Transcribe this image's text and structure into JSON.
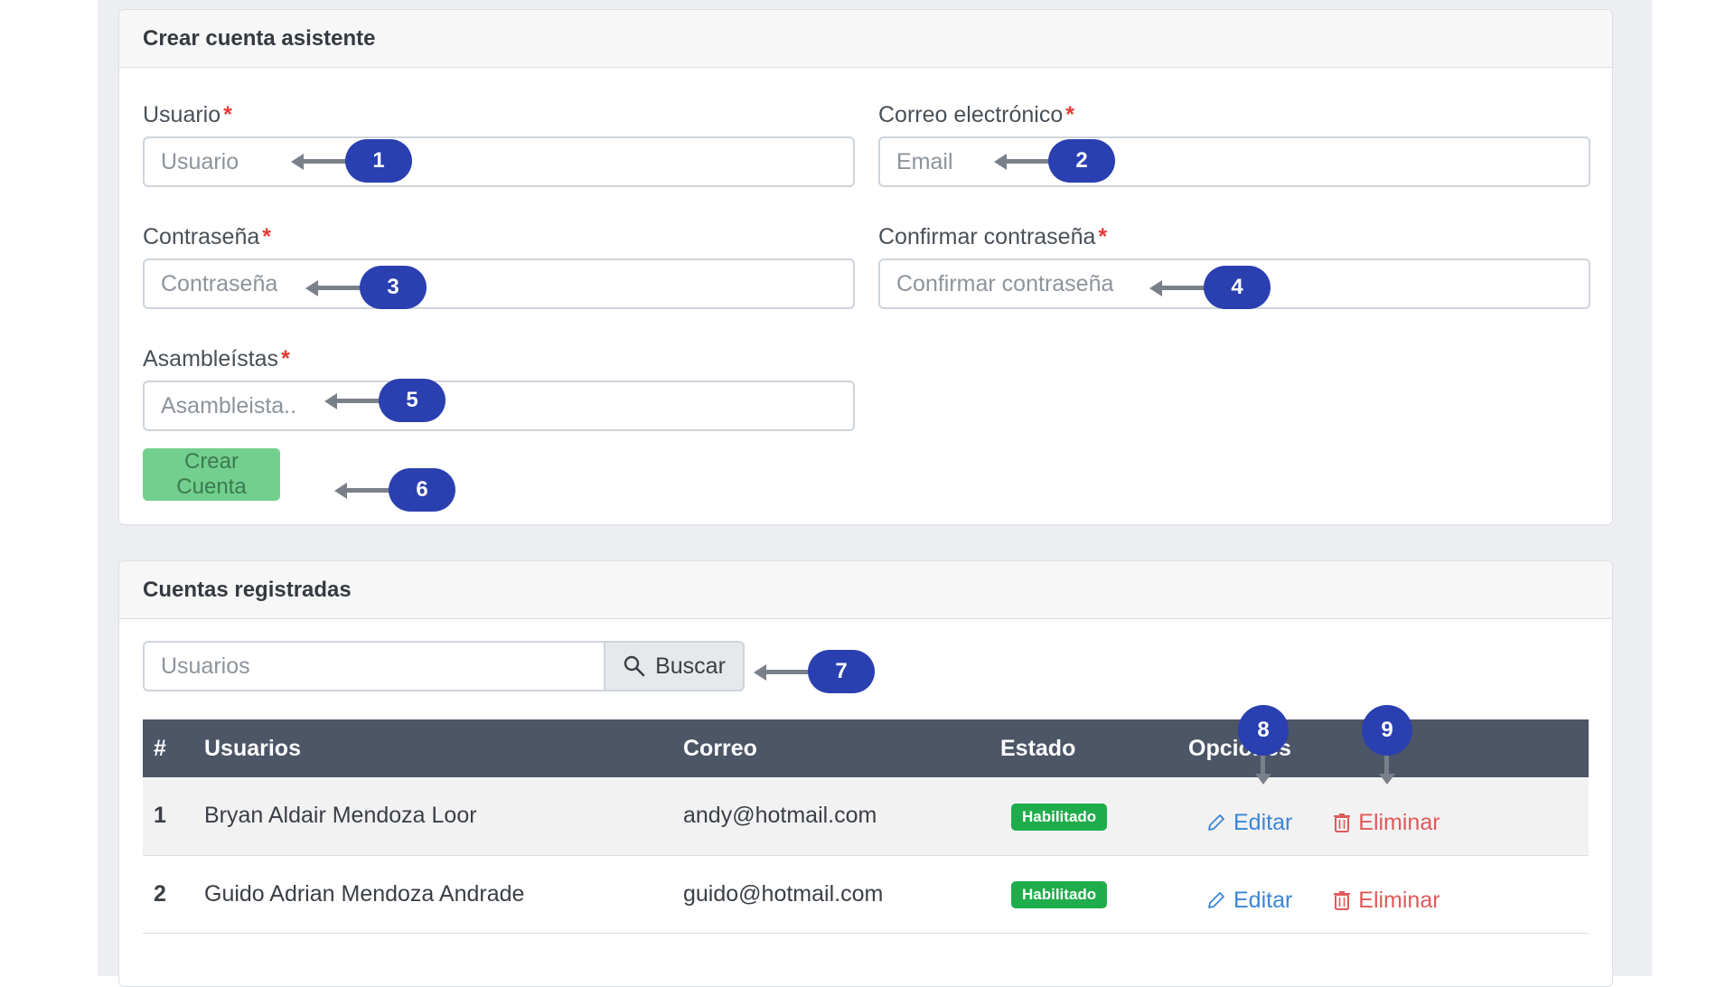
{
  "create_card": {
    "title": "Crear cuenta asistente",
    "usuario": {
      "label": "Usuario",
      "placeholder": "Usuario"
    },
    "correo": {
      "label": "Correo electrónico",
      "placeholder": "Email"
    },
    "contrasena": {
      "label": "Contraseña",
      "placeholder": "Contraseña"
    },
    "confirmar": {
      "label": "Confirmar contraseña",
      "placeholder": "Confirmar contraseña"
    },
    "asambleistas": {
      "label": "Asambleístas",
      "placeholder": "Asambleista.."
    },
    "required_mark": "*",
    "create_button": "Crear Cuenta"
  },
  "accounts_card": {
    "title": "Cuentas registradas",
    "search_placeholder": "Usuarios",
    "search_button": "Buscar",
    "columns": [
      "#",
      "Usuarios",
      "Correo",
      "Estado",
      "Opciones"
    ],
    "rows": [
      {
        "num": "1",
        "usuario": "Bryan Aldair Mendoza Loor",
        "correo": "andy@hotmail.com",
        "estado": "Habilitado",
        "editar": "Editar",
        "eliminar": "Eliminar"
      },
      {
        "num": "2",
        "usuario": "Guido Adrian Mendoza Andrade",
        "correo": "guido@hotmail.com",
        "estado": "Habilitado",
        "editar": "Editar",
        "eliminar": "Eliminar"
      }
    ]
  },
  "callouts": [
    "1",
    "2",
    "3",
    "4",
    "5",
    "6",
    "7",
    "8",
    "9"
  ],
  "colors": {
    "accent_callout": "#2a3fb0",
    "create_button": "#72cf8d",
    "table_header": "#4c5667",
    "badge_enabled": "#1fad4b",
    "edit_link": "#3a86d6",
    "delete_link": "#e05a5a"
  }
}
